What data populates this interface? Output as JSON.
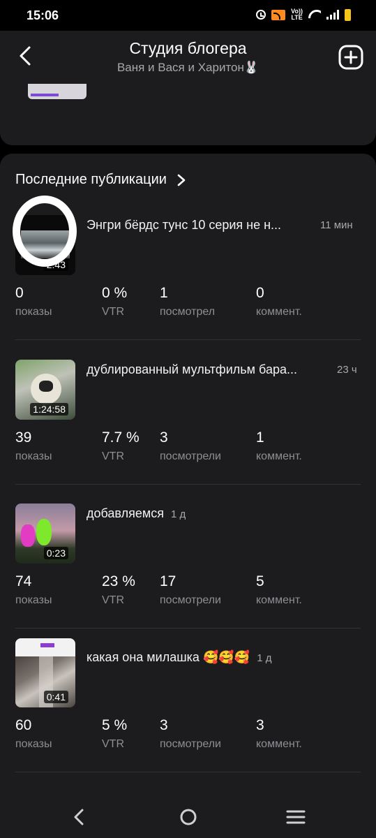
{
  "status_bar": {
    "time": "15:06",
    "volte_top": "Vo))",
    "volte_bottom": "LTE",
    "battery_color": "#f5c518",
    "cast_color": "#ff8a1d"
  },
  "header": {
    "title": "Студия блогера",
    "subtitle": "Ваня и Вася и Харитон🐰",
    "back_icon": "chevron-left-icon",
    "add_icon": "plus-square-icon"
  },
  "section": {
    "title": "Последние публикации"
  },
  "publications": [
    {
      "title": "Энгри бёрдс тунс 10 серия не н...",
      "age": "11 мин",
      "duration": "2:43",
      "stats": [
        {
          "value": "0",
          "label": "показы"
        },
        {
          "value": "0 %",
          "label": "VTR"
        },
        {
          "value": "1",
          "label": "посмотрел"
        },
        {
          "value": "0",
          "label": "коммент."
        }
      ]
    },
    {
      "title": "дублированный мультфильм бара...",
      "age": "23 ч",
      "duration": "1:24:58",
      "stats": [
        {
          "value": "39",
          "label": "показы"
        },
        {
          "value": "7.7 %",
          "label": "VTR"
        },
        {
          "value": "3",
          "label": "посмотрели"
        },
        {
          "value": "1",
          "label": "коммент."
        }
      ]
    },
    {
      "title": "добавляемся",
      "age": "1 д",
      "duration": "0:23",
      "stats": [
        {
          "value": "74",
          "label": "показы"
        },
        {
          "value": "23 %",
          "label": "VTR"
        },
        {
          "value": "17",
          "label": "посмотрели"
        },
        {
          "value": "5",
          "label": "коммент."
        }
      ]
    },
    {
      "title": "какая она милашка 🥰🥰🥰",
      "age": "1 д",
      "duration": "0:41",
      "stats": [
        {
          "value": "60",
          "label": "показы"
        },
        {
          "value": "5 %",
          "label": "VTR"
        },
        {
          "value": "3",
          "label": "посмотрели"
        },
        {
          "value": "3",
          "label": "коммент."
        }
      ]
    }
  ],
  "nav_bar": {
    "back_icon": "nav-back-icon",
    "home_icon": "nav-home-icon",
    "menu_icon": "nav-menu-icon"
  },
  "colors": {
    "background": "#000000",
    "card": "#1c1c1e",
    "secondary_text": "#8e8e93"
  }
}
